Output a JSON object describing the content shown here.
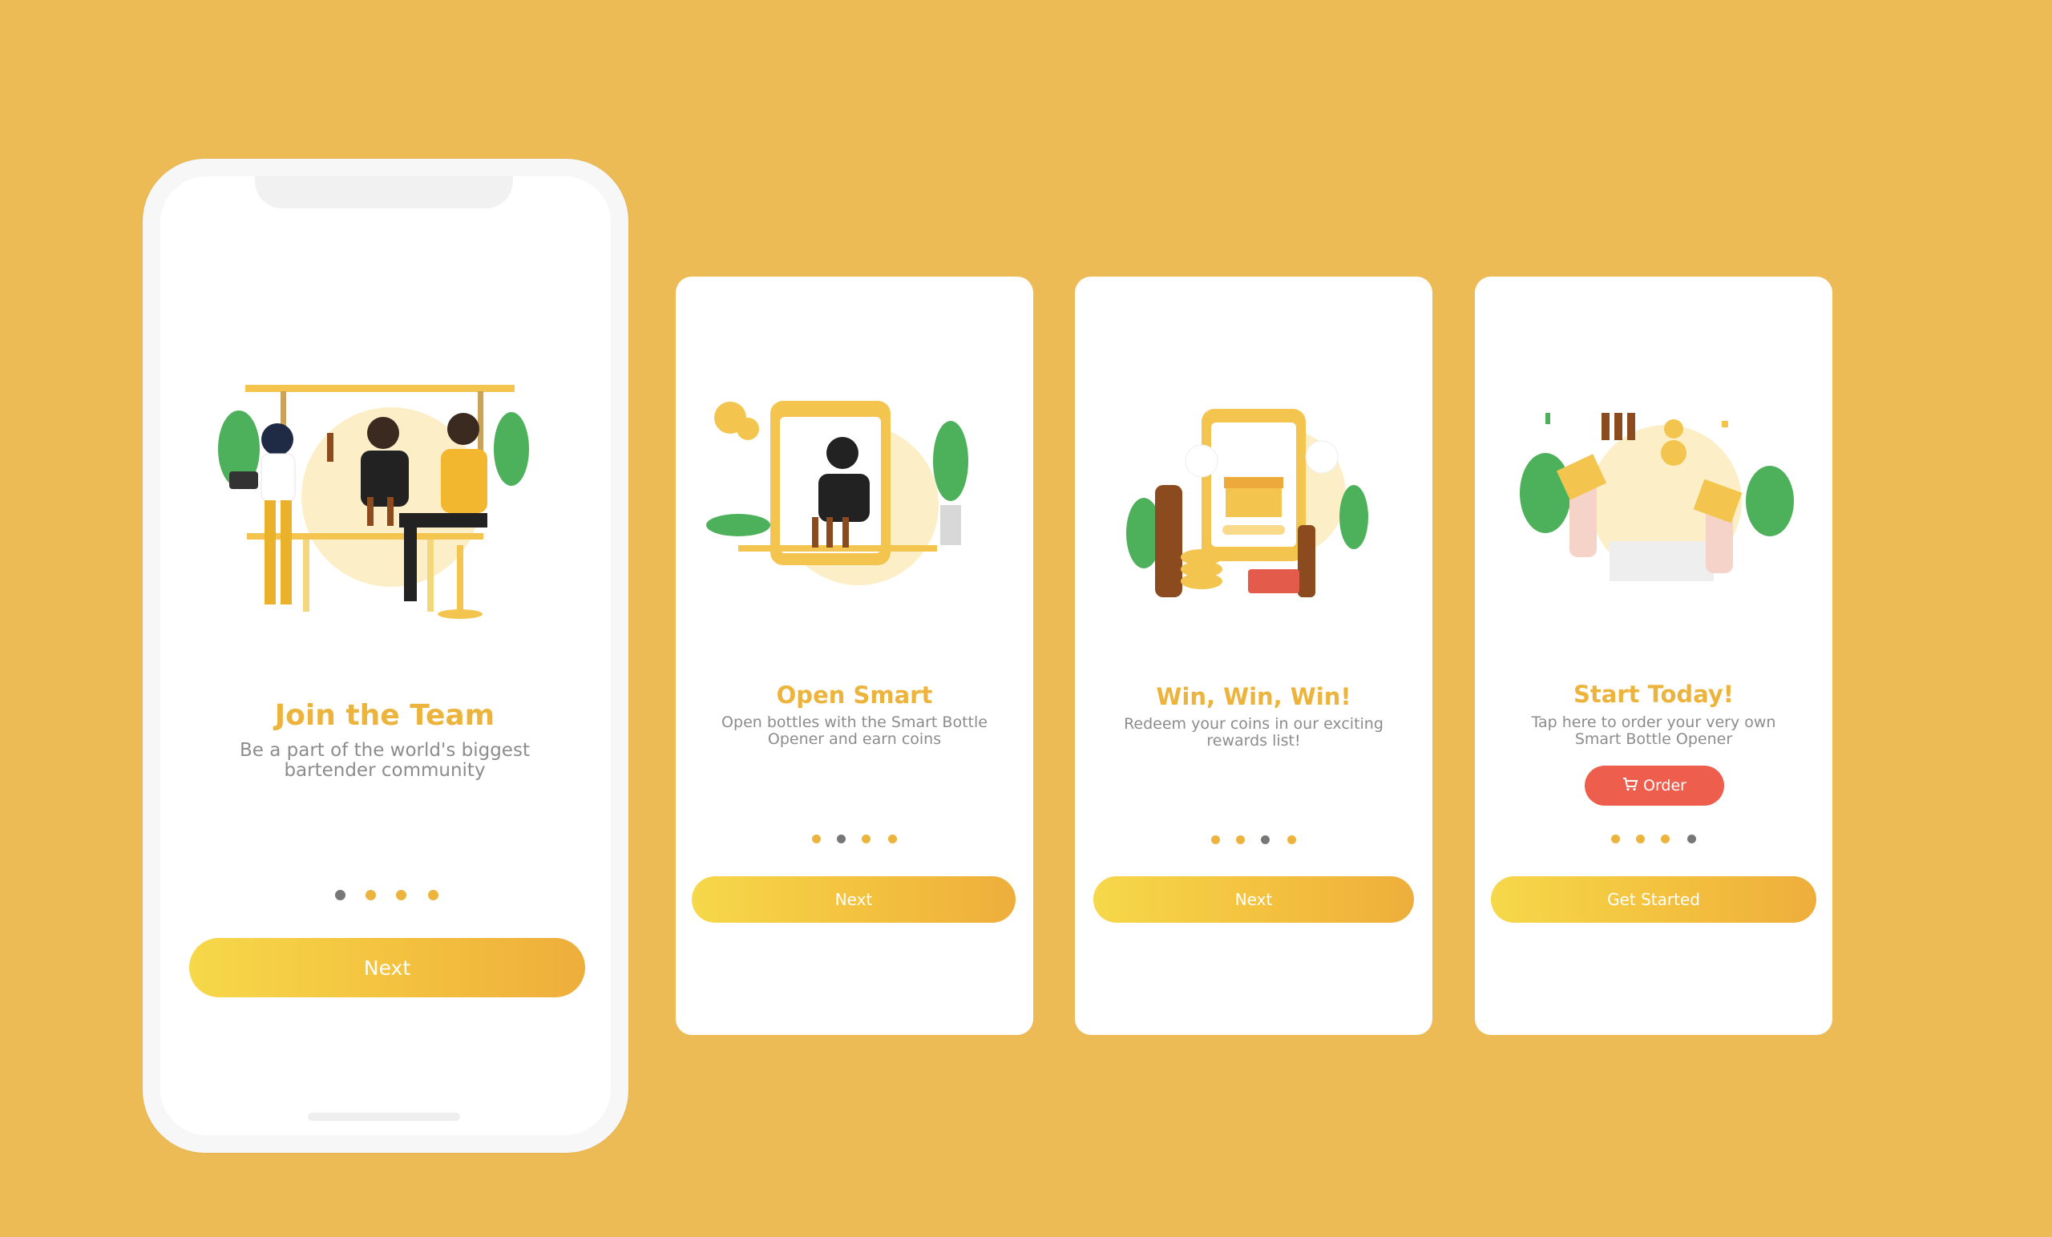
{
  "colors": {
    "background": "#EDBB56",
    "accent": "#EDB43D",
    "order_button": "#EE5E4D",
    "dot_active": "#777777"
  },
  "screens": [
    {
      "title": "Join the Team",
      "description_lines": [
        "Be a part of the world's biggest",
        "bartender community"
      ],
      "button_label": "Next",
      "active_dot": 0,
      "illustration_icon": "bartender-team-icon"
    },
    {
      "title": "Open Smart",
      "description_lines": [
        "Open bottles with the Smart Bottle",
        "Opener and earn coins"
      ],
      "button_label": "Next",
      "active_dot": 1,
      "illustration_icon": "phone-bartender-icon"
    },
    {
      "title": "Win, Win, Win!",
      "description_lines": [
        "Redeem your coins in our exciting",
        "rewards list!"
      ],
      "button_label": "Next",
      "active_dot": 2,
      "illustration_icon": "rewards-phone-icon"
    },
    {
      "title": "Start Today!",
      "description_lines": [
        "Tap here to order your very own",
        "Smart Bottle Opener"
      ],
      "order_label": "Order",
      "button_label": "Get Started",
      "active_dot": 3,
      "illustration_icon": "celebration-hands-icon"
    }
  ]
}
